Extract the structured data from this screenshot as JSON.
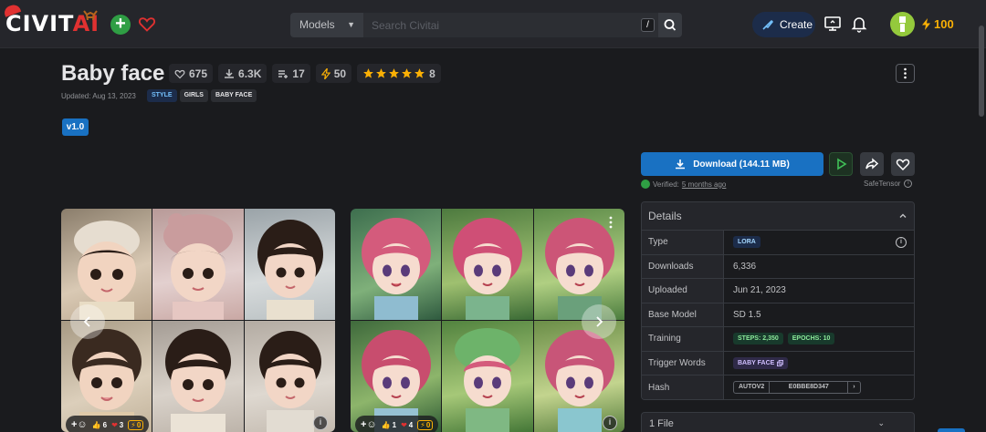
{
  "header": {
    "logo_text_a": "CIVIT",
    "logo_text_b": "AI",
    "search_scope": "Models",
    "search_placeholder": "Search Civitai",
    "search_hotkey": "/",
    "create_label": "Create",
    "buzz_amount": "100"
  },
  "model": {
    "title": "Baby face",
    "stats": {
      "likes": "675",
      "downloads": "6.3K",
      "collections": "17",
      "buzz": "50",
      "rating_count": "8",
      "rating": 5
    },
    "updated": "Updated: Aug 13, 2023",
    "tags": [
      "STYLE",
      "GIRLS",
      "BABY FACE"
    ],
    "version": "v1.0"
  },
  "actions": {
    "download_label": "Download (144.11 MB)",
    "verified_prefix": "Verified:",
    "verified_when": "5 months ago",
    "safetensor": "SafeTensor"
  },
  "gallery": [
    {
      "reactions": {
        "likes": "6",
        "hearts": "3",
        "buzz": "0"
      },
      "info": "i"
    },
    {
      "reactions": {
        "likes": "1",
        "hearts": "4",
        "buzz": "0"
      },
      "info": "i"
    }
  ],
  "details": {
    "heading": "Details",
    "rows": {
      "type": {
        "label": "Type",
        "value": "LORA"
      },
      "downloads": {
        "label": "Downloads",
        "value": "6,336"
      },
      "uploaded": {
        "label": "Uploaded",
        "value": "Jun 21, 2023"
      },
      "base_model": {
        "label": "Base Model",
        "value": "SD 1.5"
      },
      "training": {
        "label": "Training",
        "steps": "STEPS: 2,350",
        "epochs": "EPOCHS: 10"
      },
      "trigger_words": {
        "label": "Trigger Words",
        "value": "BABY FACE"
      },
      "hash": {
        "label": "Hash",
        "algo": "AUTOV2",
        "value": "E0BBE8D347"
      }
    }
  },
  "files": {
    "label": "1 File"
  },
  "colors": {
    "accent": "#1971c2",
    "buzz": "#fab005",
    "background": "#1a1b1e",
    "panel": "#25262b"
  }
}
